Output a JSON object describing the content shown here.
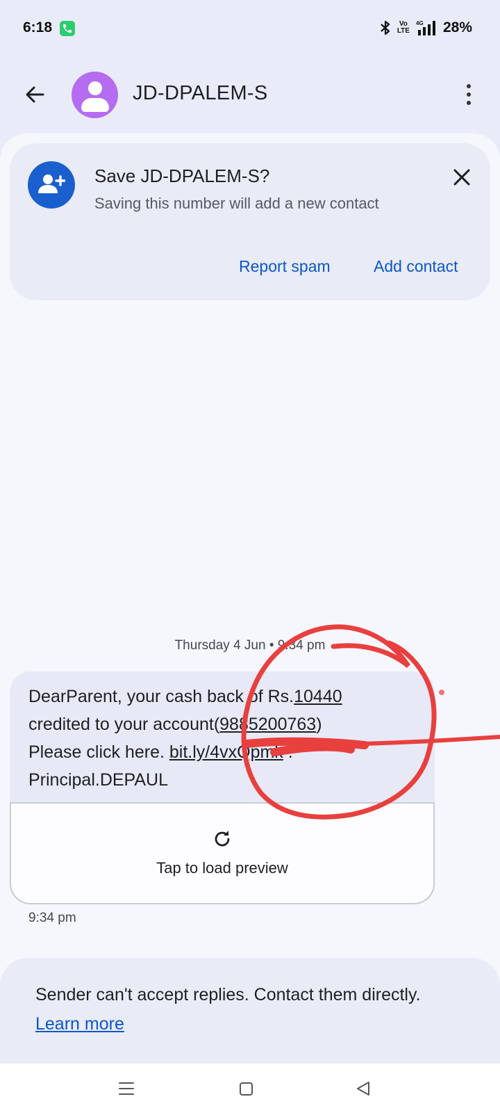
{
  "status_bar": {
    "time": "6:18",
    "volte": "Vo\nLTE",
    "network": "4G",
    "battery": "28%"
  },
  "app_bar": {
    "title": "JD-DPALEM-S",
    "icons": [
      "back-arrow-icon",
      "avatar",
      "more-vert-icon"
    ]
  },
  "save_card": {
    "title": "Save JD-DPALEM-S?",
    "subtitle": "Saving this number will add a new contact",
    "actions": {
      "report_spam": "Report spam",
      "add_contact": "Add contact"
    }
  },
  "conversation": {
    "date_header": "Thursday 4 Jun • 9:34 pm",
    "message": {
      "line1_prefix": "DearParent, your cash back of Rs.",
      "amount": "10440",
      "line2_prefix": "credited to your account(",
      "account": "9885200763",
      "line2_suffix": ")",
      "line3_prefix": "Please click here. ",
      "link": "bit.ly/4vxQpmk",
      "line3_suffix": " .",
      "line4": "Principal.DEPAUL"
    },
    "preview_label": "Tap to load preview",
    "time": "9:34 pm"
  },
  "reply_banner": {
    "text": "Sender can't accept replies. Contact them directly.",
    "link": "Learn more"
  },
  "colors": {
    "background": "#e9ecf8",
    "accent_blue": "#0b57c9",
    "avatar_purple": "#b56cf0",
    "annotation_red": "#e8403e"
  }
}
